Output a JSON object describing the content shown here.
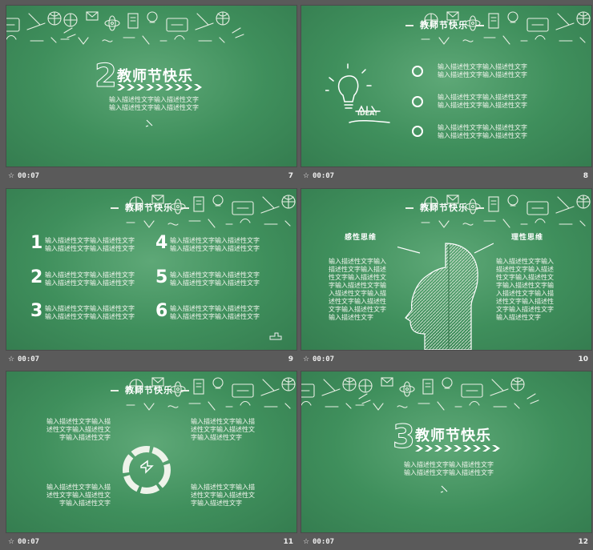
{
  "slides": [
    {
      "number": "7",
      "time": "00:07",
      "title": "教师节快乐",
      "big_digit": "2",
      "desc": [
        "输入描述性文字输入描述性文字",
        "输入描述性文字输入描述性文字"
      ]
    },
    {
      "number": "8",
      "time": "00:07",
      "title": "教师节快乐",
      "idea_label": "IDEA!",
      "items": [
        [
          "输入描述性文字输入描述性文字",
          "输入描述性文字输入描述性文字"
        ],
        [
          "输入描述性文字输入描述性文字",
          "输入描述性文字输入描述性文字"
        ],
        [
          "输入描述性文字输入描述性文字",
          "输入描述性文字输入描述性文字"
        ]
      ]
    },
    {
      "number": "9",
      "time": "00:07",
      "title": "教师节快乐",
      "nums": [
        "1",
        "4",
        "2",
        "5",
        "3",
        "6"
      ],
      "item_text": [
        "输入描述性文字输入描述性文字",
        "输入描述性文字输入描述性文字"
      ]
    },
    {
      "number": "10",
      "time": "00:07",
      "title": "教师节快乐",
      "left_label": "感性思维",
      "right_label": "理性思维",
      "left_text": [
        "输入描述性文字输入",
        "描述性文字输入描述",
        "性文字输入描述性文",
        "字输入描述性文字输",
        "入描述性文字输入描",
        "述性文字输入描述性",
        "文字输入描述性文字",
        "输入描述性文字"
      ],
      "right_text": [
        "输入描述性文字输入",
        "描述性文字输入描述",
        "性文字输入描述性文",
        "字输入描述性文字输",
        "入描述性文字输入描",
        "述性文字输入描述性",
        "文字输入描述性文字",
        "输入描述性文字"
      ]
    },
    {
      "number": "11",
      "time": "00:07",
      "title": "教师节快乐",
      "block": [
        "输入描述性文字输入描",
        "述性文字输入描述性文",
        "字输入描述性文字"
      ]
    },
    {
      "number": "12",
      "time": "00:07",
      "title": "教师节快乐",
      "big_digit": "3",
      "desc": [
        "输入描述性文字输入描述性文字",
        "输入描述性文字输入描述性文字"
      ]
    }
  ],
  "icons": {
    "star": "☆"
  }
}
